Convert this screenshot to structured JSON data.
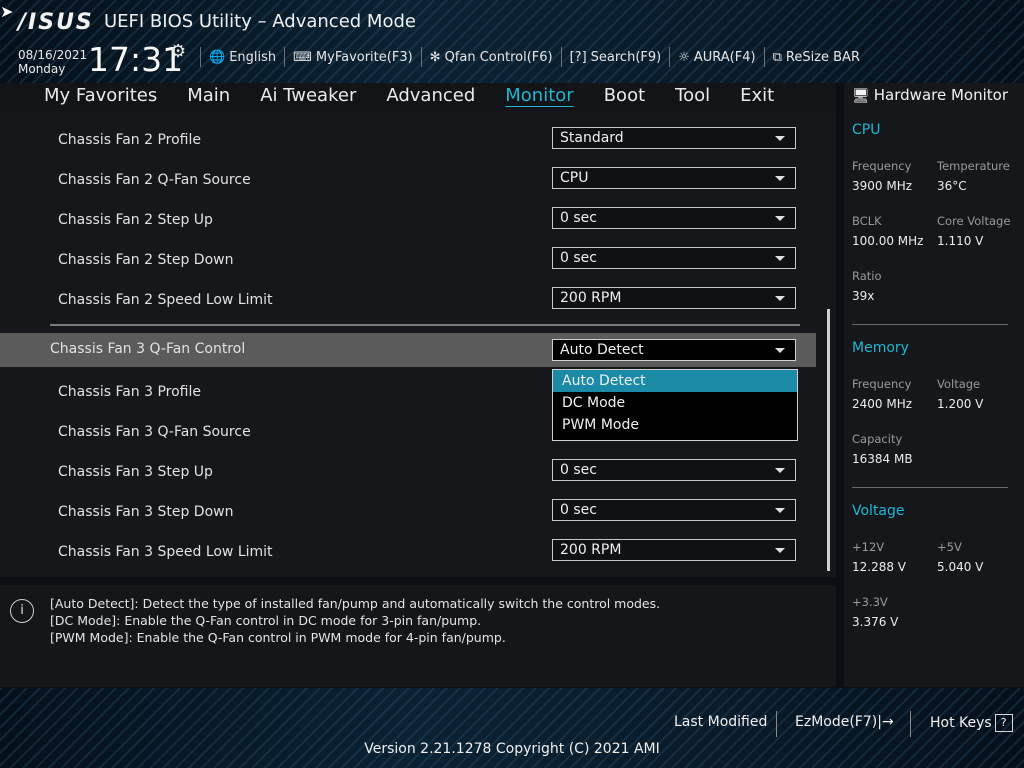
{
  "header": {
    "brand": "/ISUS",
    "title": "UEFI BIOS Utility – Advanced Mode",
    "date": "08/16/2021",
    "weekday": "Monday",
    "time": "17:31",
    "toolbar": [
      {
        "icon": "globe-icon",
        "label": "English"
      },
      {
        "icon": "keyboard-icon",
        "label": "MyFavorite(F3)"
      },
      {
        "icon": "fan-icon",
        "label": "Qfan Control(F6)"
      },
      {
        "icon": "question-icon",
        "label": "Search(F9)"
      },
      {
        "icon": "light-icon",
        "label": "AURA(F4)"
      },
      {
        "icon": "resize-icon",
        "label": "ReSize BAR"
      }
    ]
  },
  "tabs": [
    "My Favorites",
    "Main",
    "Ai Tweaker",
    "Advanced",
    "Monitor",
    "Boot",
    "Tool",
    "Exit"
  ],
  "active_tab": "Monitor",
  "settings": [
    {
      "label": "Chassis Fan 2 Profile",
      "value": "Standard"
    },
    {
      "label": "Chassis Fan 2 Q-Fan Source",
      "value": "CPU"
    },
    {
      "label": "Chassis Fan 2 Step Up",
      "value": "0 sec"
    },
    {
      "label": "Chassis Fan 2 Step Down",
      "value": "0 sec"
    },
    {
      "label": "Chassis Fan 2 Speed Low Limit",
      "value": "200 RPM"
    },
    {
      "label": "Chassis Fan 3 Q-Fan Control",
      "value": "Auto Detect"
    },
    {
      "label": "Chassis Fan 3 Profile",
      "value": ""
    },
    {
      "label": "Chassis Fan 3 Q-Fan Source",
      "value": ""
    },
    {
      "label": "Chassis Fan 3 Step Up",
      "value": "0 sec"
    },
    {
      "label": "Chassis Fan 3 Step Down",
      "value": "0 sec"
    },
    {
      "label": "Chassis Fan 3 Speed Low Limit",
      "value": "200 RPM"
    }
  ],
  "dropdown": {
    "options": [
      "Auto Detect",
      "DC Mode",
      "PWM Mode"
    ],
    "selected": "Auto Detect"
  },
  "help": [
    "[Auto Detect]: Detect the type of installed fan/pump and automatically switch the control modes.",
    "[DC Mode]: Enable the Q-Fan control in DC mode for 3-pin fan/pump.",
    "[PWM Mode]: Enable the Q-Fan control in PWM mode for 4-pin fan/pump."
  ],
  "hardware_monitor": {
    "title": "Hardware Monitor",
    "cpu": {
      "heading": "CPU",
      "frequency_label": "Frequency",
      "frequency": "3900 MHz",
      "temperature_label": "Temperature",
      "temperature": "36°C",
      "bclk_label": "BCLK",
      "bclk": "100.00 MHz",
      "core_voltage_label": "Core Voltage",
      "core_voltage": "1.110 V",
      "ratio_label": "Ratio",
      "ratio": "39x"
    },
    "memory": {
      "heading": "Memory",
      "frequency_label": "Frequency",
      "frequency": "2400 MHz",
      "voltage_label": "Voltage",
      "voltage": "1.200 V",
      "capacity_label": "Capacity",
      "capacity": "16384 MB"
    },
    "voltage": {
      "heading": "Voltage",
      "v12_label": "+12V",
      "v12": "12.288 V",
      "v5_label": "+5V",
      "v5": "5.040 V",
      "v33_label": "+3.3V",
      "v33": "3.376 V"
    }
  },
  "footer": {
    "last_modified": "Last Modified",
    "ezmode": "EzMode(F7)|→",
    "hotkeys": "Hot Keys",
    "hotkeys_key": "?",
    "version": "Version 2.21.1278 Copyright (C) 2021 AMI"
  },
  "colors": {
    "accent": "#1fb7d4",
    "selected_row": "#5b5b5b",
    "dropdown_active": "#1a8aa6"
  }
}
